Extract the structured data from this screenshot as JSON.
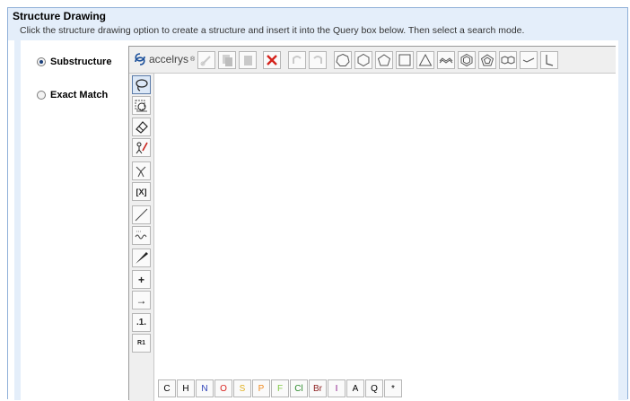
{
  "panel": {
    "title": "Structure Drawing",
    "instructions": "Click the structure drawing option to create a structure and insert it into the Query box below. Then select a search mode."
  },
  "modes": [
    {
      "label": "Substructure",
      "selected": true
    },
    {
      "label": "Exact Match",
      "selected": false
    }
  ],
  "editor": {
    "brand": "accelrys",
    "brand_mark": "®",
    "toolbar_icons": [
      "eraser-icon",
      "copy-icon",
      "paste-icon",
      "delete-icon",
      "undo-icon",
      "redo-icon",
      "cycloheptane-icon",
      "cyclohexane-icon",
      "cyclopentane-icon",
      "cyclobutane-icon",
      "cyclopropane-icon",
      "chain-icon",
      "benzene-icon",
      "cyclopentadiene-icon",
      "naphthalene-icon",
      "bond-chain-icon",
      "angle-icon"
    ],
    "left_tools": [
      {
        "icon": "lasso-icon"
      },
      {
        "icon": "rotate-icon"
      },
      {
        "icon": "eraser-icon"
      },
      {
        "icon": "atom-pen-icon"
      },
      {
        "icon": "stereo-icon"
      },
      {
        "icon": "bracket-icon",
        "text": "[X]"
      },
      {
        "icon": "single-bond-icon"
      },
      {
        "icon": "wavy-bond-icon"
      },
      {
        "icon": "wedge-bond-icon"
      },
      {
        "icon": "charge-icon",
        "text": "+"
      },
      {
        "icon": "reaction-arrow-icon",
        "text": "→"
      },
      {
        "icon": "atom-map-icon",
        "text": ".1."
      },
      {
        "icon": "rgroup-icon",
        "text": "R1"
      }
    ],
    "atoms": [
      {
        "symbol": "C",
        "color": "#000000"
      },
      {
        "symbol": "H",
        "color": "#000000"
      },
      {
        "symbol": "N",
        "color": "#2a3fb8"
      },
      {
        "symbol": "O",
        "color": "#d9231f"
      },
      {
        "symbol": "S",
        "color": "#e0b020"
      },
      {
        "symbol": "P",
        "color": "#f08a1e"
      },
      {
        "symbol": "F",
        "color": "#7fc843"
      },
      {
        "symbol": "Cl",
        "color": "#2b8a2b"
      },
      {
        "symbol": "Br",
        "color": "#8a1b1b"
      },
      {
        "symbol": "I",
        "color": "#8a1b8a"
      },
      {
        "symbol": "A",
        "color": "#000000"
      },
      {
        "symbol": "Q",
        "color": "#000000"
      },
      {
        "symbol": "*",
        "color": "#000000"
      }
    ]
  }
}
